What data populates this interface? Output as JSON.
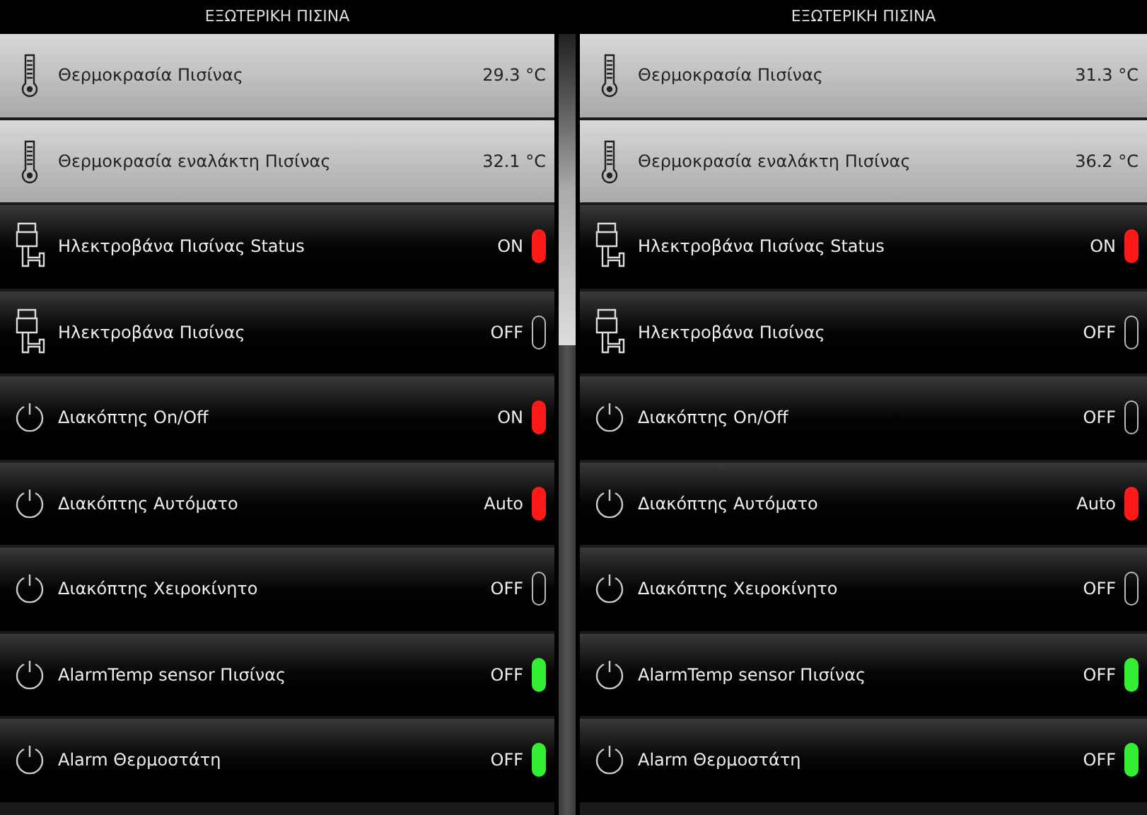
{
  "panels": [
    {
      "title": "ΕΞΩΤΕΡΙΚΗ ΠΙΣΙΝΑ",
      "rows": [
        {
          "kind": "sensor",
          "label": "Θερμοκρασία Πισίνας",
          "value": "29.3 °C"
        },
        {
          "kind": "sensor",
          "label": "Θερμοκρασία εναλάκτη Πισίνας",
          "value": "32.1 °C"
        },
        {
          "kind": "valve",
          "label": "Ηλεκτροβάνα Πισίνας Status",
          "value": "ON",
          "lit": true,
          "color": "#ff1a1a"
        },
        {
          "kind": "valve",
          "label": "Ηλεκτροβάνα Πισίνας",
          "value": "OFF",
          "lit": false
        },
        {
          "kind": "switch",
          "label": "Διακόπτης On/Off",
          "value": "ON",
          "lit": true,
          "color": "#ff1a1a"
        },
        {
          "kind": "switch",
          "label": "Διακόπτης Αυτόματο",
          "value": "Auto",
          "lit": true,
          "color": "#ff1a1a"
        },
        {
          "kind": "switch",
          "label": "Διακόπτης Χειροκίνητο",
          "value": "OFF",
          "lit": false
        },
        {
          "kind": "switch",
          "label": "AlarmTemp sensor Πισίνας",
          "value": "OFF",
          "lit": true,
          "color": "#33ee33"
        },
        {
          "kind": "switch",
          "label": "Alarm Θερμοστάτη",
          "value": "OFF",
          "lit": true,
          "color": "#33ee33"
        }
      ]
    },
    {
      "title": "ΕΞΩΤΕΡΙΚΗ ΠΙΣΙΝΑ",
      "rows": [
        {
          "kind": "sensor",
          "label": "Θερμοκρασία Πισίνας",
          "value": "31.3 °C"
        },
        {
          "kind": "sensor",
          "label": "Θερμοκρασία εναλάκτη Πισίνας",
          "value": "36.2 °C"
        },
        {
          "kind": "valve",
          "label": "Ηλεκτροβάνα Πισίνας Status",
          "value": "ON",
          "lit": true,
          "color": "#ff1a1a"
        },
        {
          "kind": "valve",
          "label": "Ηλεκτροβάνα Πισίνας",
          "value": "OFF",
          "lit": false
        },
        {
          "kind": "switch",
          "label": "Διακόπτης On/Off",
          "value": "OFF",
          "lit": false
        },
        {
          "kind": "switch",
          "label": "Διακόπτης Αυτόματο",
          "value": "Auto",
          "lit": true,
          "color": "#ff1a1a"
        },
        {
          "kind": "switch",
          "label": "Διακόπτης Χειροκίνητο",
          "value": "OFF",
          "lit": false
        },
        {
          "kind": "switch",
          "label": "AlarmTemp sensor Πισίνας",
          "value": "OFF",
          "lit": true,
          "color": "#33ee33"
        },
        {
          "kind": "switch",
          "label": "Alarm Θερμοστάτη",
          "value": "OFF",
          "lit": true,
          "color": "#33ee33"
        }
      ]
    }
  ]
}
